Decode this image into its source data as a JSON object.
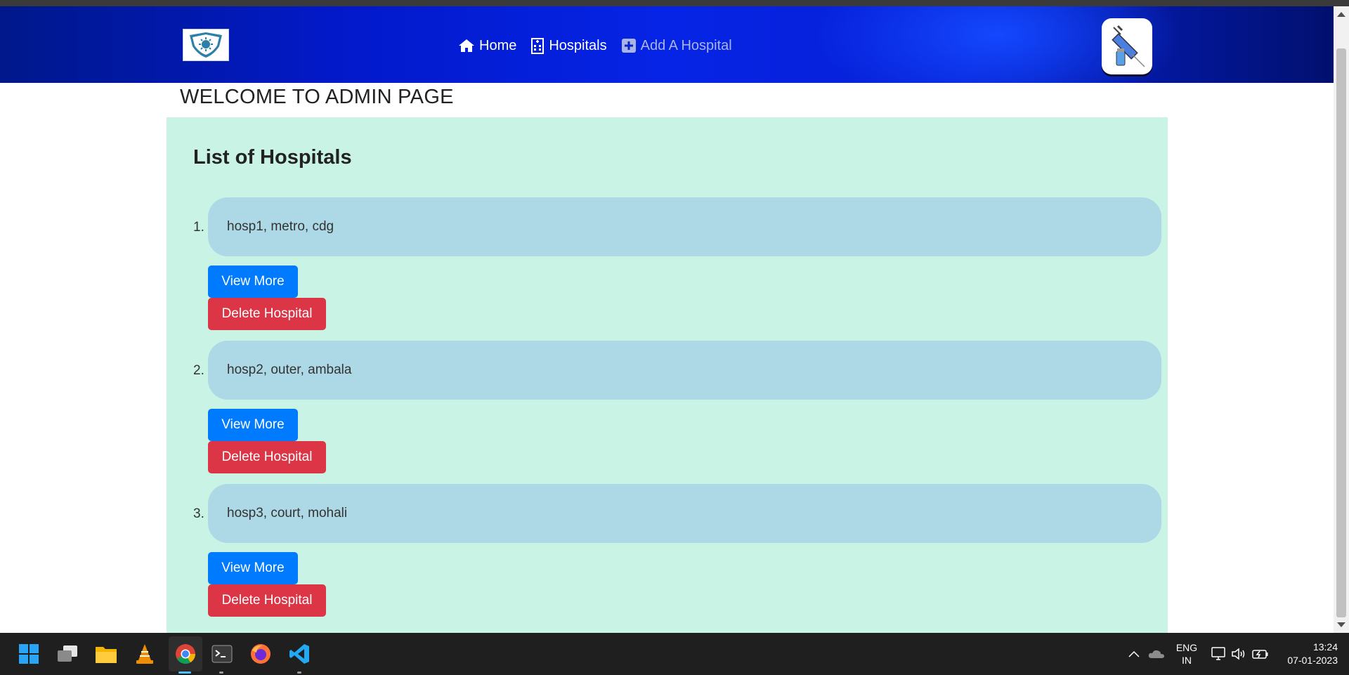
{
  "nav": {
    "links": [
      {
        "label": "Home",
        "icon": "home-icon"
      },
      {
        "label": "Hospitals",
        "icon": "hospital-icon"
      },
      {
        "label": "Add A Hospital",
        "icon": "plus-square-icon"
      }
    ]
  },
  "page": {
    "title": "WELCOME TO ADMIN PAGE"
  },
  "main": {
    "list_title": "List of Hospitals",
    "hospitals": [
      {
        "number": "1.",
        "text": "hosp1, metro, cdg",
        "view_label": "View More",
        "delete_label": "Delete Hospital"
      },
      {
        "number": "2.",
        "text": "hosp2, outer, ambala",
        "view_label": "View More",
        "delete_label": "Delete Hospital"
      },
      {
        "number": "3.",
        "text": "hosp3, court, mohali",
        "view_label": "View More",
        "delete_label": "Delete Hospital"
      }
    ]
  },
  "taskbar": {
    "lang_line1": "ENG",
    "lang_line2": "IN",
    "time": "13:24",
    "date": "07-01-2023"
  },
  "colors": {
    "nav_gradient": "#0624e6",
    "panel_bg": "#c9f3e5",
    "card_bg": "#add8e6",
    "view_button": "#007bff",
    "delete_button": "#dc3545"
  }
}
